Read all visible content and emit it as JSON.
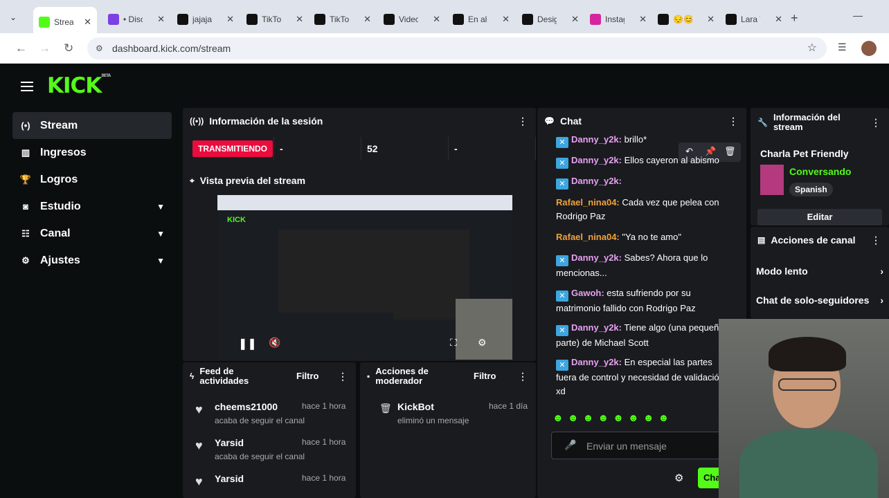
{
  "browser": {
    "tabs": [
      {
        "label": "Stream",
        "color": "#53fc18",
        "active": true
      },
      {
        "label": "• Disc",
        "color": "#7b3fe4"
      },
      {
        "label": "jajaja",
        "color": "#111"
      },
      {
        "label": "TikTok",
        "color": "#111"
      },
      {
        "label": "TikTok",
        "color": "#111"
      },
      {
        "label": "Video",
        "color": "#111"
      },
      {
        "label": "En alg",
        "color": "#111"
      },
      {
        "label": "Desig",
        "color": "#111"
      },
      {
        "label": "Instag",
        "color": "#d6249f"
      },
      {
        "label": "😔😊",
        "color": "#111"
      },
      {
        "label": "Lara V",
        "color": "#111"
      }
    ],
    "url": "dashboard.kick.com/stream"
  },
  "logo": "KICK",
  "logo_tag": "BETA",
  "sidebar": [
    {
      "label": "Stream",
      "icon": "broadcast-icon"
    },
    {
      "label": "Ingresos",
      "icon": "bar-chart-icon"
    },
    {
      "label": "Logros",
      "icon": "trophy-icon"
    },
    {
      "label": "Estudio",
      "icon": "studio-icon"
    },
    {
      "label": "Canal",
      "icon": "channel-icon"
    },
    {
      "label": "Ajustes",
      "icon": "gear-icon"
    }
  ],
  "session": {
    "title": "Información de la sesión",
    "status": "TRANSMITIENDO",
    "stat1": "-",
    "stat2": "52",
    "stat3": "-"
  },
  "preview": {
    "title": "Vista previa del stream"
  },
  "feed": {
    "title": "Feed de actividades",
    "filter": "Filtro",
    "rows": [
      {
        "name": "cheems21000",
        "time": "hace 1 hora",
        "desc": "acaba de seguir el canal"
      },
      {
        "name": "Yarsid",
        "time": "hace 1 hora",
        "desc": "acaba de seguir el canal"
      },
      {
        "name": "Yarsid",
        "time": "hace 1 hora",
        "desc": ""
      }
    ]
  },
  "mod": {
    "title": "Acciones de moderador",
    "filter": "Filtro",
    "rows": [
      {
        "name": "KickBot",
        "time": "hace 1 día",
        "desc": "eliminó un mensaje"
      }
    ]
  },
  "chat": {
    "title": "Chat",
    "placeholder": "Enviar un mensaje",
    "send": "Chat",
    "messages": [
      {
        "user": "Danny_y2k:",
        "color": "#e8a0f0",
        "badge": true,
        "text": "brillo*"
      },
      {
        "user": "Danny_y2k:",
        "color": "#e8a0f0",
        "badge": true,
        "text": "Ellos cayeron al abismo"
      },
      {
        "user": "Danny_y2k:",
        "color": "#e8a0f0",
        "badge": true,
        "text": ""
      },
      {
        "user": "Rafael_nina04:",
        "color": "#f0a23a",
        "badge": false,
        "text": "Cada vez que pelea con Rodrigo Paz"
      },
      {
        "user": "Rafael_nina04:",
        "color": "#f0a23a",
        "badge": false,
        "text": "\"Ya no te amo\""
      },
      {
        "user": "Danny_y2k:",
        "color": "#e8a0f0",
        "badge": true,
        "text": "Sabes? Ahora que lo mencionas..."
      },
      {
        "user": "Gawoh:",
        "color": "#e8a0f0",
        "badge": true,
        "text": "esta sufriendo por su matrimonio fallido con Rodrigo Paz"
      },
      {
        "user": "Danny_y2k:",
        "color": "#e8a0f0",
        "badge": true,
        "text": "Tiene algo (una pequeña parte) de Michael Scott"
      },
      {
        "user": "Danny_y2k:",
        "color": "#e8a0f0",
        "badge": true,
        "text": "En especial las partes fuera de control y necesidad de validación xd"
      }
    ]
  },
  "info": {
    "title": "Información del stream",
    "stream_title": "Charla Pet Friendly",
    "category": "Conversando",
    "tag": "Spanish",
    "edit": "Editar"
  },
  "actions": {
    "title": "Acciones de canal",
    "items": [
      "Modo lento",
      "Chat de solo-seguidores"
    ]
  },
  "colors": {
    "accent": "#53fc18",
    "live": "#eb0b3d",
    "panel": "#191b1f"
  }
}
